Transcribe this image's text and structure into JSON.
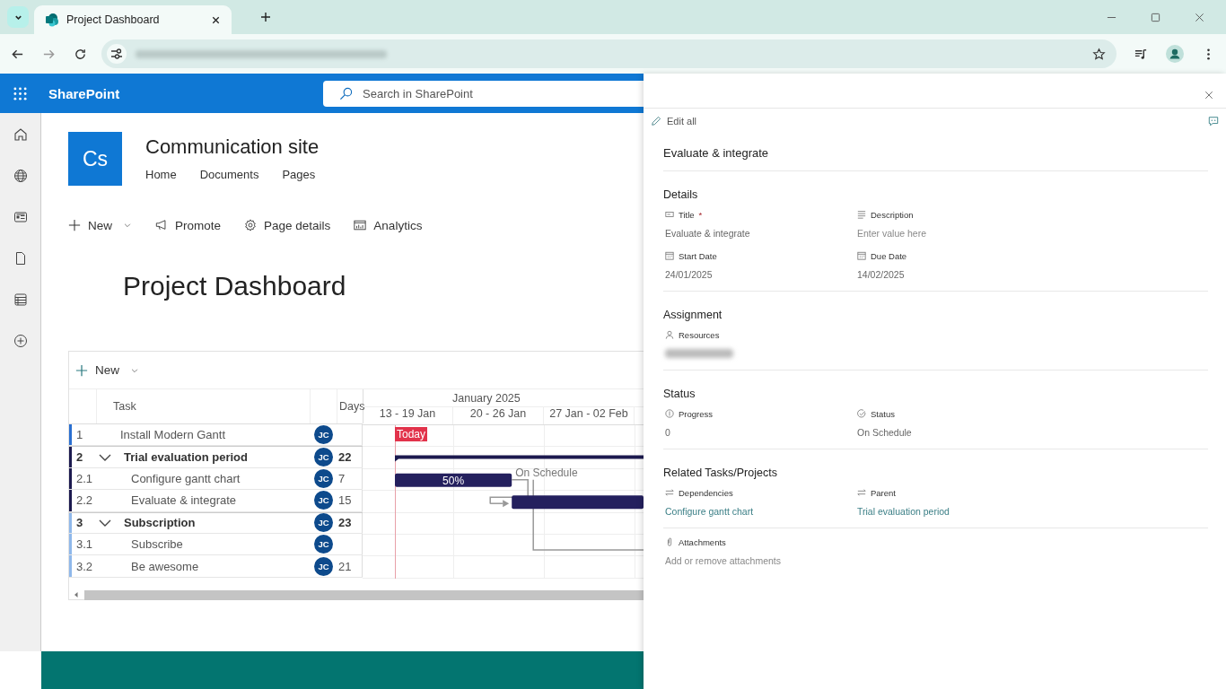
{
  "browser": {
    "tab_title": "Project Dashboard"
  },
  "header": {
    "app_name": "SharePoint",
    "search": {
      "placeholder": "Search in SharePoint"
    }
  },
  "site": {
    "logo": "Cs",
    "name": "Communication site",
    "nav": [
      "Home",
      "Documents",
      "Pages"
    ]
  },
  "command_bar": [
    {
      "kind": "new",
      "label": "New"
    },
    {
      "kind": "promote",
      "label": "Promote"
    },
    {
      "kind": "details",
      "label": "Page details"
    },
    {
      "kind": "analytics",
      "label": "Analytics"
    }
  ],
  "page_title": "Project Dashboard",
  "gantt": {
    "new_button": "New",
    "columns": [
      "Task",
      "Days"
    ],
    "month": "January 2025",
    "weeks": [
      "13 - 19 Jan",
      "20 - 26 Jan",
      "27 Jan - 02 Feb"
    ],
    "today": "Today",
    "rows": [
      {
        "id": "1",
        "task": "Install Modern Gantt",
        "resource": "JC",
        "color": "#2a6fd0"
      },
      {
        "id": "2",
        "task": "Trial evaluation period",
        "resource": "JC",
        "days": "22",
        "color": "#1c1a4f",
        "expanded": true,
        "children": [
          {
            "id": "2.1",
            "task": "Configure gantt chart",
            "resource": "JC",
            "days": "7",
            "bar_label": "50%",
            "note": "On Schedule",
            "links_to_next": true
          },
          {
            "id": "2.2",
            "task": "Evaluate & integrate",
            "resource": "JC",
            "days": "15"
          }
        ]
      },
      {
        "id": "3",
        "task": "Subscription",
        "resource": "JC",
        "days": "23",
        "color": "#8fb8ea",
        "expanded": true,
        "children": [
          {
            "id": "3.1",
            "task": "Subscribe",
            "resource": "JC"
          },
          {
            "id": "3.2",
            "task": "Be awesome",
            "resource": "JC",
            "days": "21"
          }
        ]
      }
    ]
  },
  "panel": {
    "edit_all": "Edit all",
    "title": "Evaluate & integrate",
    "sections": [
      {
        "heading": "Details",
        "fields": [
          {
            "kind": "text",
            "label": "Title",
            "required_mark": "*",
            "value": "Evaluate & integrate"
          },
          {
            "kind": "lines",
            "label": "Description",
            "placeholder": "Enter value here"
          },
          {
            "kind": "date",
            "label": "Start Date",
            "value": "24/01/2025"
          },
          {
            "kind": "date",
            "label": "Due Date",
            "value": "14/02/2025"
          }
        ]
      },
      {
        "heading": "Assignment",
        "fields": [
          {
            "kind": "person",
            "label": "Resources",
            "blurred": true
          }
        ]
      },
      {
        "heading": "Status",
        "fields": [
          {
            "kind": "progress",
            "label": "Progress",
            "value": "0"
          },
          {
            "kind": "status",
            "label": "Status",
            "value": "On Schedule"
          }
        ]
      },
      {
        "heading": "Related Tasks/Projects",
        "fields": [
          {
            "kind": "link",
            "label": "Dependencies",
            "value": "Configure gantt chart"
          },
          {
            "kind": "link",
            "label": "Parent",
            "value": "Trial evaluation period"
          }
        ]
      },
      {
        "fields": [
          {
            "kind": "attach",
            "label": "Attachments",
            "placeholder": "Add or remove attachments"
          }
        ]
      }
    ]
  }
}
